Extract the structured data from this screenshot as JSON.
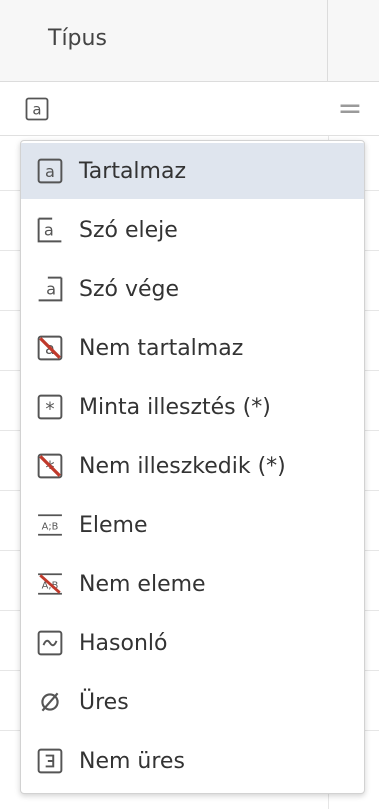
{
  "column": {
    "title": "Típus"
  },
  "filter": {
    "operator_symbol": "=",
    "selected_icon": "contains-icon"
  },
  "menu": {
    "selected_index": 0,
    "items": [
      {
        "label": "Tartalmaz",
        "icon": "contains-icon"
      },
      {
        "label": "Szó eleje",
        "icon": "starts-with-icon"
      },
      {
        "label": "Szó vége",
        "icon": "ends-with-icon"
      },
      {
        "label": "Nem tartalmaz",
        "icon": "not-contains-icon"
      },
      {
        "label": "Minta illesztés (*)",
        "icon": "wildcard-match-icon"
      },
      {
        "label": "Nem illeszkedik (*)",
        "icon": "not-wildcard-match-icon"
      },
      {
        "label": "Eleme",
        "icon": "in-list-icon"
      },
      {
        "label": "Nem eleme",
        "icon": "not-in-list-icon"
      },
      {
        "label": "Hasonló",
        "icon": "similar-icon"
      },
      {
        "label": "Üres",
        "icon": "empty-icon"
      },
      {
        "label": "Nem üres",
        "icon": "not-empty-icon"
      }
    ]
  },
  "colors": {
    "selected_bg": "#dfe5ee",
    "icon_stroke": "#555555",
    "strike_red": "#c0392b"
  }
}
